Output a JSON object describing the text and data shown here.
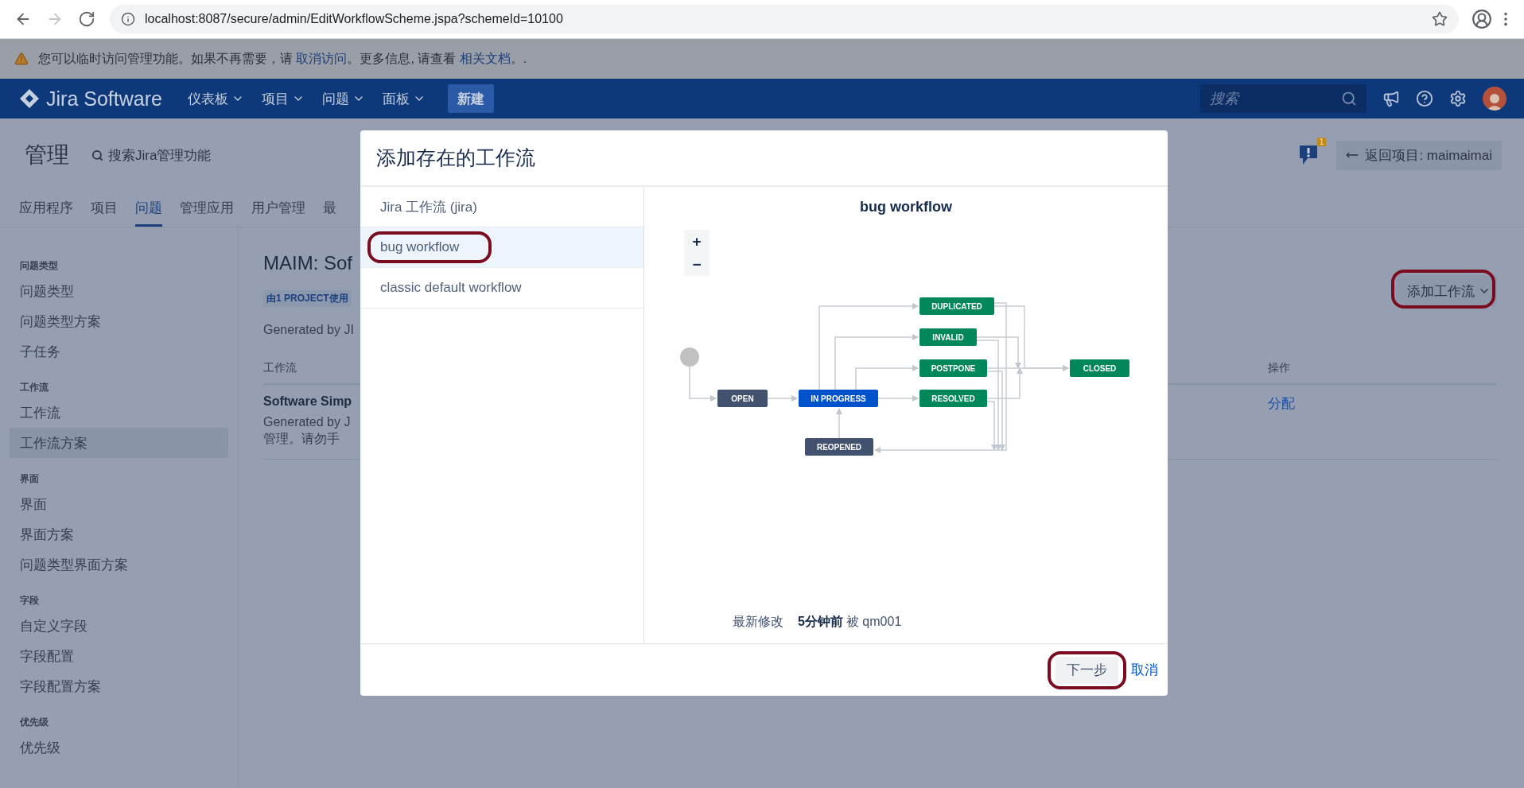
{
  "browser": {
    "nav": [
      {
        "kind": "back",
        "disabled": false
      },
      {
        "kind": "forward",
        "disabled": true
      },
      {
        "kind": "reload",
        "disabled": false
      }
    ],
    "url": "localhost:8087/secure/admin/EditWorkflowScheme.jspa?schemeId=10100"
  },
  "warning": {
    "parts": [
      {
        "kind": "text",
        "text": "您可以临时访问管理功能。如果不再需要，请 "
      },
      {
        "kind": "link",
        "text": "取消访问"
      },
      {
        "kind": "text",
        "text": "。更多信息, 请查看 "
      },
      {
        "kind": "link",
        "text": "相关文档"
      },
      {
        "kind": "text",
        "text": "。."
      }
    ]
  },
  "header": {
    "logo": "Jira Software",
    "nav": [
      {
        "label": "仪表板"
      },
      {
        "label": "项目"
      },
      {
        "label": "问题"
      },
      {
        "label": "面板"
      }
    ],
    "create": "新建",
    "search": {
      "placeholder": "搜索"
    }
  },
  "admin": {
    "title": "管理",
    "search_link": "搜索Jira管理功能",
    "notification_count": "1",
    "back_button": "返回项目: maimaimai",
    "tabs": [
      {
        "label": "应用程序",
        "selected": false
      },
      {
        "label": "项目",
        "selected": false
      },
      {
        "label": "问题",
        "selected": true
      },
      {
        "label": "管理应用",
        "selected": false
      },
      {
        "label": "用户管理",
        "selected": false
      },
      {
        "label": "最",
        "selected": false
      }
    ]
  },
  "sidebar": {
    "sections": [
      {
        "heading": "问题类型",
        "items": [
          {
            "label": "问题类型",
            "selected": false
          },
          {
            "label": "问题类型方案",
            "selected": false
          },
          {
            "label": "子任务",
            "selected": false
          }
        ]
      },
      {
        "heading": "工作流",
        "items": [
          {
            "label": "工作流",
            "selected": false
          },
          {
            "label": "工作流方案",
            "selected": true
          }
        ]
      },
      {
        "heading": "界面",
        "items": [
          {
            "label": "界面",
            "selected": false
          },
          {
            "label": "界面方案",
            "selected": false
          },
          {
            "label": "问题类型界面方案",
            "selected": false
          }
        ]
      },
      {
        "heading": "字段",
        "items": [
          {
            "label": "自定义字段",
            "selected": false
          },
          {
            "label": "字段配置",
            "selected": false
          },
          {
            "label": "字段配置方案",
            "selected": false
          }
        ]
      },
      {
        "heading": "优先级",
        "items": [
          {
            "label": "优先级",
            "selected": false
          }
        ]
      }
    ]
  },
  "content": {
    "title": "MAIM: Sof",
    "usage": "由1 PROJECT使用",
    "description": "Generated by JI",
    "add_button": "添加工作流",
    "table": {
      "columns": [
        {
          "label": "工作流"
        },
        {
          "label": "操作"
        }
      ],
      "rows": [
        {
          "name": "Software Simp",
          "description_lines": [
            "Generated by J",
            "管理。请勿手"
          ],
          "action": "分配"
        }
      ]
    }
  },
  "dialog": {
    "title": "添加存在的工作流",
    "workflows": [
      {
        "label": "Jira 工作流 (jira)",
        "selected": false
      },
      {
        "label": "bug workflow",
        "selected": true
      },
      {
        "label": "classic default workflow",
        "selected": false
      }
    ],
    "preview": {
      "title": "bug workflow",
      "zoom_in": "+",
      "zoom_out": "−",
      "statuses": [
        {
          "label": "OPEN",
          "color": "#42526e"
        },
        {
          "label": "IN PROGRESS",
          "color": "#0052cc"
        },
        {
          "label": "DUPLICATED",
          "color": "#00875a"
        },
        {
          "label": "INVALID",
          "color": "#00875a"
        },
        {
          "label": "POSTPONE",
          "color": "#00875a"
        },
        {
          "label": "RESOLVED",
          "color": "#00875a"
        },
        {
          "label": "CLOSED",
          "color": "#00875a"
        },
        {
          "label": "REOPENED",
          "color": "#42526e"
        }
      ],
      "modified_label": "最新修改",
      "modified_time": "5分钟前",
      "modified_by": "被 qm001"
    },
    "buttons": [
      {
        "label": "下一步",
        "kind": "primary"
      },
      {
        "label": "取消",
        "kind": "link"
      }
    ]
  }
}
